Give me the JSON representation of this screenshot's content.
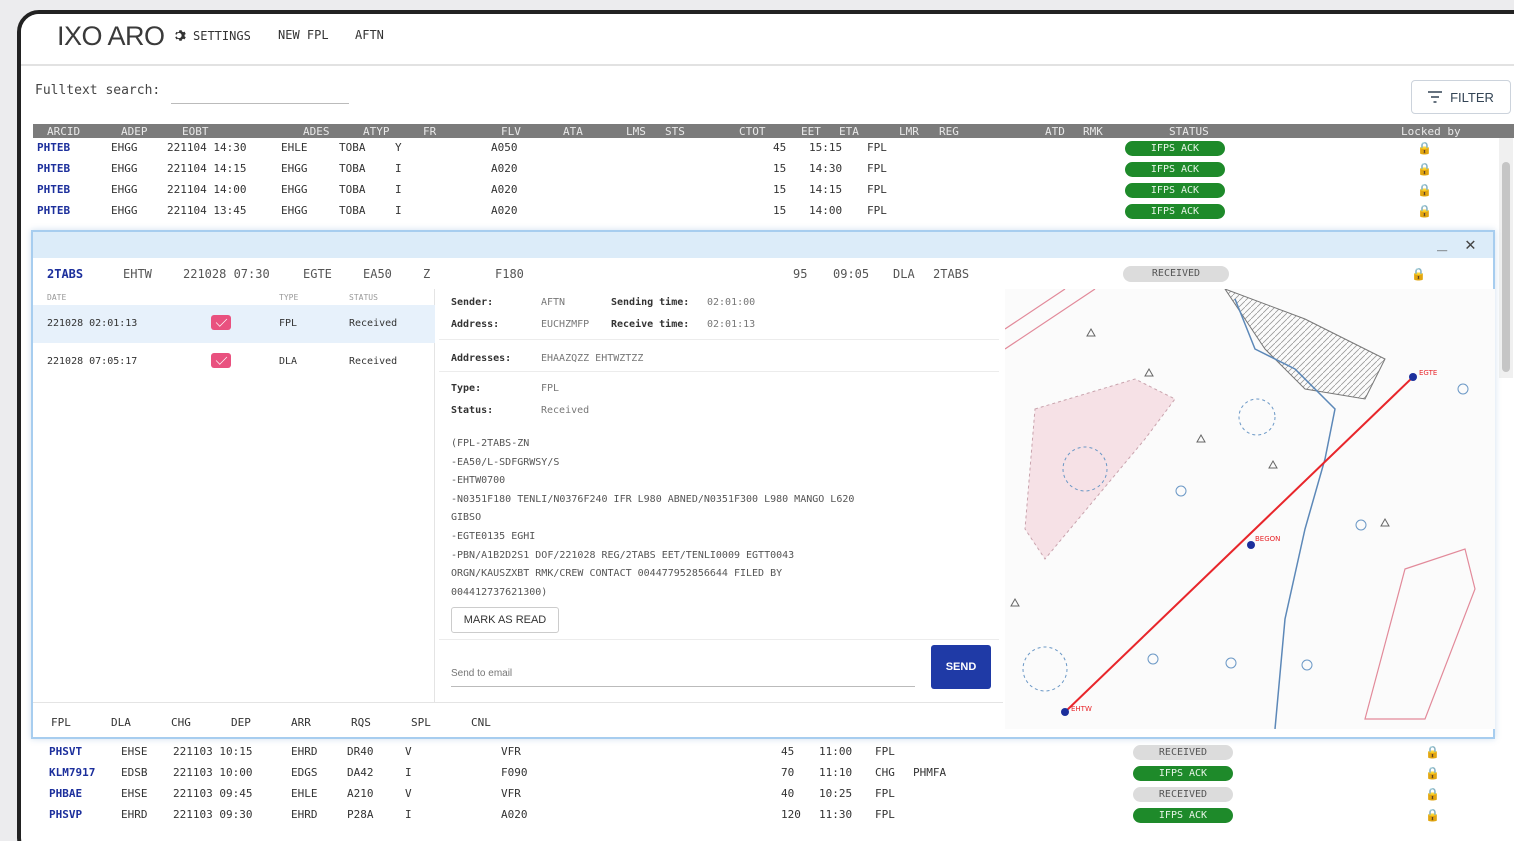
{
  "app": {
    "title": "IXO ARO"
  },
  "nav": {
    "settings": "SETTINGS",
    "new_fpl": "NEW FPL",
    "aftn": "AFTN"
  },
  "search": {
    "label": "Fulltext search:",
    "value": ""
  },
  "filter": {
    "label": "FILTER"
  },
  "columns": {
    "arcid": "ARCID",
    "adep": "ADEP",
    "eobt": "EOBT",
    "ades": "ADES",
    "atyp": "ATYP",
    "fr": "FR",
    "flv": "FLV",
    "ata": "ATA",
    "lms": "LMS",
    "sts": "STS",
    "ctot": "CTOT",
    "eet": "EET",
    "eta": "ETA",
    "lmr": "LMR",
    "reg": "REG",
    "atd": "ATD",
    "rmk": "RMK",
    "status": "STATUS",
    "locked_by": "Locked by"
  },
  "rows_top": [
    {
      "arcid": "PHTEB",
      "adep": "EHGG",
      "eobt": "221104 14:30",
      "ades": "EHLE",
      "atyp": "TOBA",
      "fr": "Y",
      "flv": "A050",
      "eet": "45",
      "eta": "15:15",
      "lmr": "FPL",
      "status": "IFPS ACK"
    },
    {
      "arcid": "PHTEB",
      "adep": "EHGG",
      "eobt": "221104 14:15",
      "ades": "EHGG",
      "atyp": "TOBA",
      "fr": "I",
      "flv": "A020",
      "eet": "15",
      "eta": "14:30",
      "lmr": "FPL",
      "status": "IFPS ACK"
    },
    {
      "arcid": "PHTEB",
      "adep": "EHGG",
      "eobt": "221104 14:00",
      "ades": "EHGG",
      "atyp": "TOBA",
      "fr": "I",
      "flv": "A020",
      "eet": "15",
      "eta": "14:15",
      "lmr": "FPL",
      "status": "IFPS ACK"
    },
    {
      "arcid": "PHTEB",
      "adep": "EHGG",
      "eobt": "221104 13:45",
      "ades": "EHGG",
      "atyp": "TOBA",
      "fr": "I",
      "flv": "A020",
      "eet": "15",
      "eta": "14:00",
      "lmr": "FPL",
      "status": "IFPS ACK"
    }
  ],
  "rows_bottom": [
    {
      "arcid": "PHSVT",
      "adep": "EHSE",
      "eobt": "221103 10:15",
      "ades": "EHRD",
      "atyp": "DR40",
      "fr": "V",
      "flv": "VFR",
      "eet": "45",
      "eta": "11:00",
      "lmr": "FPL",
      "reg": "",
      "status": "RECEIVED"
    },
    {
      "arcid": "KLM7917",
      "adep": "EDSB",
      "eobt": "221103 10:00",
      "ades": "EDGS",
      "atyp": "DA42",
      "fr": "I",
      "flv": "F090",
      "eet": "70",
      "eta": "11:10",
      "lmr": "CHG",
      "reg": "PHMFA",
      "status": "IFPS ACK"
    },
    {
      "arcid": "PHBAE",
      "adep": "EHSE",
      "eobt": "221103 09:45",
      "ades": "EHLE",
      "atyp": "A210",
      "fr": "V",
      "flv": "VFR",
      "eet": "40",
      "eta": "10:25",
      "lmr": "FPL",
      "reg": "",
      "status": "RECEIVED"
    },
    {
      "arcid": "PHSVP",
      "adep": "EHRD",
      "eobt": "221103 09:30",
      "ades": "EHRD",
      "atyp": "P28A",
      "fr": "I",
      "flv": "A020",
      "eet": "120",
      "eta": "11:30",
      "lmr": "FPL",
      "reg": "",
      "status": "IFPS ACK"
    }
  ],
  "modal": {
    "flight": {
      "arcid": "2TABS",
      "adep": "EHTW",
      "eobt": "221028 07:30",
      "ades": "EGTE",
      "atyp": "EA50",
      "fr": "Z",
      "flv": "F180",
      "eet": "95",
      "eta": "09:05",
      "lmr": "DLA",
      "reg": "2TABS",
      "status": "RECEIVED"
    },
    "list_headers": {
      "date": "DATE",
      "type": "TYPE",
      "status": "STATUS"
    },
    "messages": [
      {
        "date": "221028 02:01:13",
        "type": "FPL",
        "status": "Received"
      },
      {
        "date": "221028 07:05:17",
        "type": "DLA",
        "status": "Received"
      }
    ],
    "detail": {
      "sender_label": "Sender:",
      "sender": "AFTN",
      "sending_time_label": "Sending time:",
      "sending_time": "02:01:00",
      "address_label": "Address:",
      "address": "EUCHZMFP",
      "receive_time_label": "Receive time:",
      "receive_time": "02:01:13",
      "addresses_label": "Addresses:",
      "addresses": "EHAAZQZZ EHTWZTZZ",
      "type_label": "Type:",
      "type": "FPL",
      "status_label": "Status:",
      "status": "Received",
      "fpl_lines": [
        "(FPL-2TABS-ZN",
        "-EA50/L-SDFGRWSY/S",
        "-EHTW0700",
        "-N0351F180 TENLI/N0376F240 IFR L980 ABNED/N0351F300 L980 MANGO L620",
        "GIBSO",
        "-EGTE0135 EGHI",
        "-PBN/A1B2D2S1 DOF/221028 REG/2TABS EET/TENLI0009 EGTT0043",
        "ORGN/KAUSZXBT RMK/CREW CONTACT 004477952856644 FILED BY",
        "004412737621300)"
      ],
      "mark_read": "MARK AS READ",
      "email_placeholder": "Send to email",
      "send": "SEND"
    },
    "tabs": [
      "FPL",
      "DLA",
      "CHG",
      "DEP",
      "ARR",
      "RQS",
      "SPL",
      "CNL"
    ],
    "map_labels": {
      "start": "EHTW",
      "end": "EGTE",
      "mid": "BEGON"
    }
  },
  "colors": {
    "accent": "#1f3aa6",
    "ack": "#1e8a2a",
    "route": "#e8262b",
    "header": "#7b7b7b",
    "modal_border": "#a7cdef"
  },
  "icons": {
    "settings": "gear-icon",
    "filter": "filter-icon",
    "lock": "lock-icon",
    "envelope": "envelope-icon",
    "close": "close-icon",
    "minimize": "minimize-icon"
  }
}
